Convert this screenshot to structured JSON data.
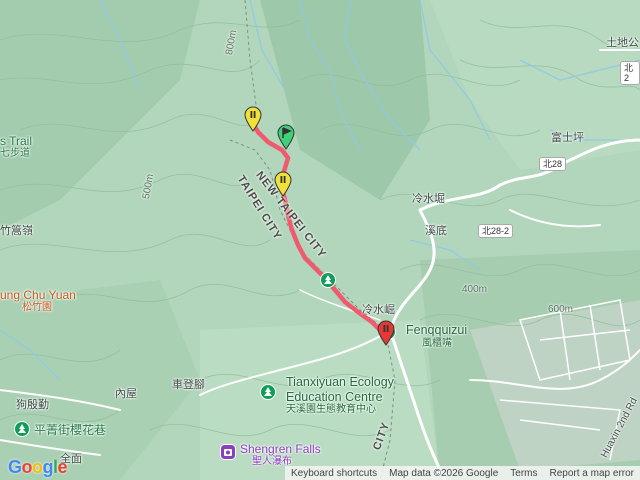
{
  "labels": {
    "trail_partial": "s Trail",
    "trail_partial_cn": "七步道",
    "gaoling": "竹篙嶺",
    "yuan_en": "ung Chu Yuan",
    "yuan_cn": "松竹園",
    "neiwu": "內屋",
    "cheden": "車登腳",
    "gouyin": "狗殷勤",
    "pingqing": "平菁街櫻花巷",
    "quanwei": "全面",
    "lengshui_keng": "冷水堀",
    "xidi": "溪底",
    "lengshui_ku": "冷水崛",
    "fujikeng": "富士坪",
    "tudi": "土地公",
    "fenqquizui_en": "Fenqquizui",
    "fenqquizui_cn": "風櫃嘴",
    "tianxiyuan_en1": "Tianxiyuan Ecology",
    "tianxiyuan_en2": "Education Centre",
    "tianxiyuan_cn": "天溪園生態教育中心",
    "shengren_en": "Shengren Falls",
    "shengren_cn": "聖人瀑布",
    "city1": "NEW TAIPEI CITY",
    "city2": "TAIPEI CITY",
    "city_bottom": "CITY",
    "huaxin": "Huaxin 2nd Rd",
    "contour_400": "400m",
    "contour_600": "600m",
    "contour_800": "800m",
    "contour_500": "500m"
  },
  "shields": {
    "bei28": "北28",
    "bei28_2": "北28-2",
    "bei28_top": "北2"
  },
  "footer": {
    "shortcuts": "Keyboard shortcuts",
    "mapdata": "Map data ©2026 Google",
    "terms": "Terms",
    "report": "Report a map error"
  },
  "logo": "Google",
  "colors": {
    "route": "#f05a6e",
    "marker_yellow": "#f2e03a",
    "marker_green": "#3fd07a",
    "marker_red": "#e53935",
    "poi_green": "#0f9d58",
    "poi_purple": "#8a3fbf"
  }
}
